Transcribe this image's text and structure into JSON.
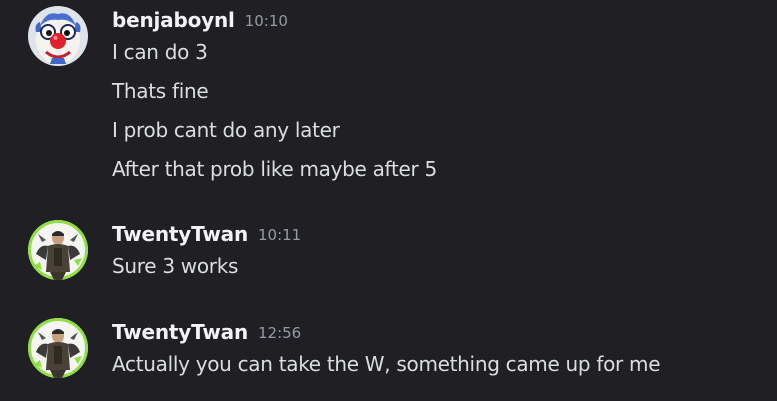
{
  "groups": [
    {
      "username": "benjaboynl",
      "timestamp": "10:10",
      "avatar_icon": "clown-avatar-icon",
      "messages": [
        "I can do 3",
        "Thats fine",
        "I prob cant do any later",
        "After that prob like maybe after 5"
      ]
    },
    {
      "username": "TwentyTwan",
      "timestamp": "10:11",
      "avatar_icon": "person-avatar-icon",
      "messages": [
        "Sure 3 works"
      ]
    },
    {
      "username": "TwentyTwan",
      "timestamp": "12:56",
      "avatar_icon": "person-avatar-icon",
      "messages": [
        "Actually you can take the W, something came up for me"
      ]
    }
  ],
  "colors": {
    "background": "#1f1f24",
    "username": "#f2f3f5",
    "timestamp": "#949ba4",
    "message_text": "#dbdee1",
    "avatar_ring": "#8ee040"
  }
}
